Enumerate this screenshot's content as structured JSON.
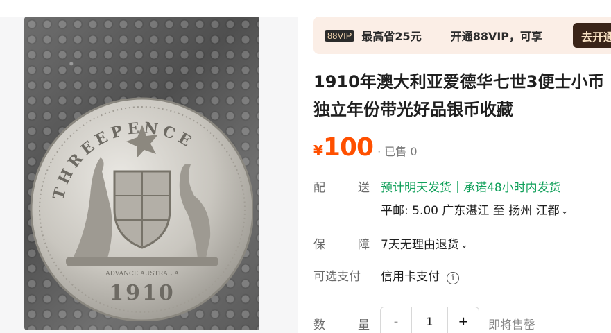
{
  "promo": {
    "badge": "88VIP",
    "save_text": "最高省25元",
    "open_text": "开通88VIP，可享",
    "button": "去开通"
  },
  "product": {
    "title": "1910年澳大利亚爱德华七世3便士小币 独立年份带光好品银币收藏",
    "currency": "¥",
    "price": "100",
    "sold": "· 已售 0"
  },
  "shipping": {
    "label_a": "配",
    "label_b": "送",
    "ship_text": "预计明天发货",
    "promise_text": "｜承诺48小时内发货",
    "postage": "平邮: 5.00  广东湛江  至  扬州 江都"
  },
  "guarantee": {
    "label_a": "保",
    "label_b": "障",
    "text": "7天无理由退货"
  },
  "payment": {
    "label": "可选支付",
    "text": "信用卡支付",
    "info_icon": "i"
  },
  "quantity": {
    "label_a": "数",
    "label_b": "量",
    "minus": "-",
    "value": "1",
    "plus": "+",
    "status": "即将售罄"
  },
  "coin": {
    "legend": "THREEPENCE",
    "year": "1910",
    "motto": "ADVANCE AUSTRALIA"
  },
  "colors": {
    "price": "#ff5000",
    "ship_green": "#10a05a",
    "promo_bg": "#fbeee6",
    "promo_button": "#3a2418"
  }
}
